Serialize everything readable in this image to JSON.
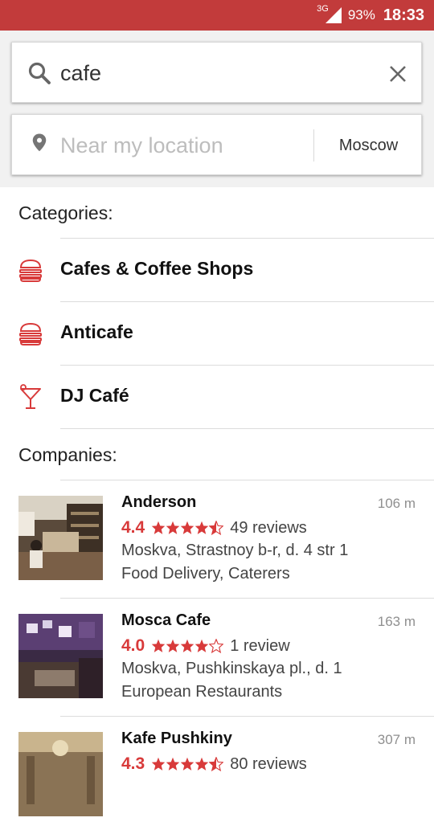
{
  "status_bar": {
    "network": "3G",
    "battery": "93%",
    "time": "18:33"
  },
  "search": {
    "query": "cafe",
    "location_placeholder": "Near my location",
    "city": "Moscow",
    "icons": {
      "search": "search-icon",
      "clear": "close-icon",
      "location": "location-pin-icon"
    }
  },
  "categories_title": "Categories:",
  "categories": [
    {
      "label": "Cafes & Coffee Shops",
      "icon": "burger-icon"
    },
    {
      "label": "Anticafe",
      "icon": "burger-icon"
    },
    {
      "label": "DJ Café",
      "icon": "cocktail-icon"
    }
  ],
  "companies_title": "Companies:",
  "companies": [
    {
      "name": "Anderson",
      "distance": "106 m",
      "rating": "4.4",
      "stars": 4.5,
      "reviews": "49 reviews",
      "address": "Moskva, Strastnoy b-r, d. 4 str 1",
      "type": "Food Delivery, Caterers"
    },
    {
      "name": "Mosca Cafe",
      "distance": "163 m",
      "rating": "4.0",
      "stars": 4,
      "reviews": "1 review",
      "address": "Moskva, Pushkinskaya pl., d. 1",
      "type": "European Restaurants"
    },
    {
      "name": "Kafe Pushkiny",
      "distance": "307 m",
      "rating": "4.3",
      "stars": 4.5,
      "reviews": "80 reviews",
      "address": "",
      "type": ""
    }
  ],
  "colors": {
    "accent": "#d83a3a",
    "status_bar": "#c23b3b"
  }
}
